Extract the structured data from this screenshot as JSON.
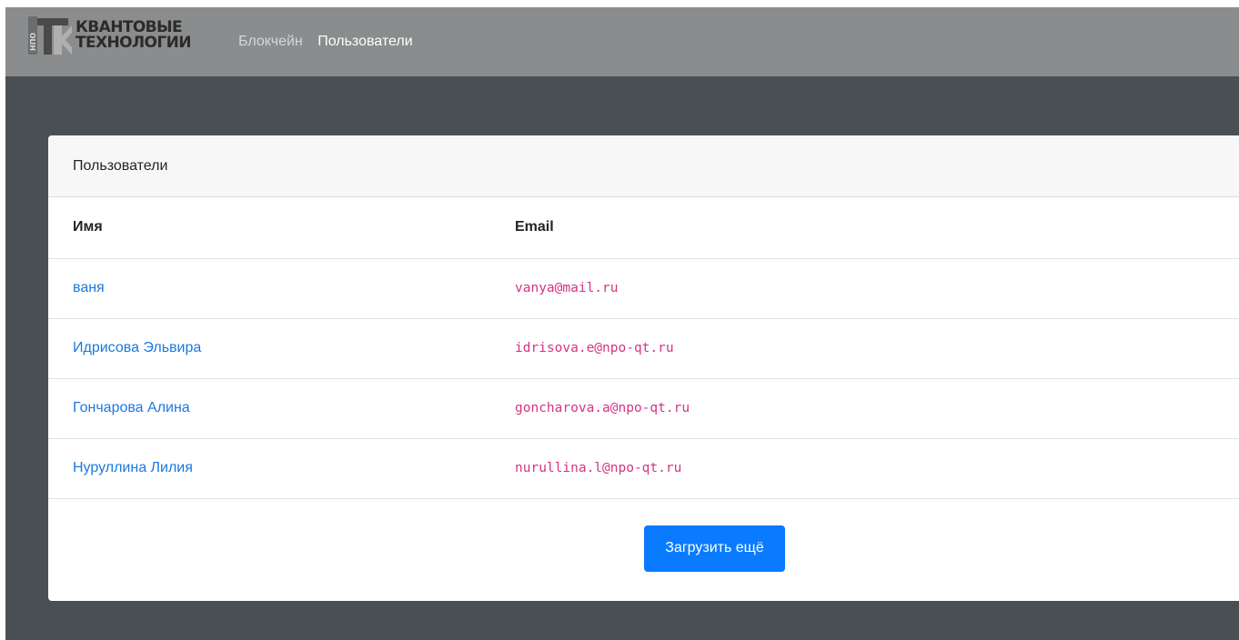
{
  "navbar": {
    "logo": {
      "side_text": "НПО",
      "monogram": "K",
      "line1": "КВАНТОВЫЕ",
      "line2": "ТЕХНОЛОГИИ"
    },
    "links": [
      {
        "label": "Блокчейн",
        "active": false
      },
      {
        "label": "Пользователи",
        "active": true
      }
    ]
  },
  "card": {
    "header": "Пользователи",
    "columns": [
      "Имя",
      "Email"
    ],
    "rows": [
      {
        "name": "ваня",
        "email": "vanya@mail.ru"
      },
      {
        "name": "Идрисова Эльвира",
        "email": "idrisova.e@npo-qt.ru"
      },
      {
        "name": "Гончарова Алина",
        "email": "goncharova.a@npo-qt.ru"
      },
      {
        "name": "Нуруллина Лилия",
        "email": "nurullina.l@npo-qt.ru"
      }
    ],
    "load_more_label": "Загрузить ещё"
  },
  "colors": {
    "navbar_bg": "#8a8c8d",
    "page_bg": "#4a4f53",
    "link": "#1a7ae0",
    "email": "#d63384",
    "primary_button": "#0a7bff"
  }
}
